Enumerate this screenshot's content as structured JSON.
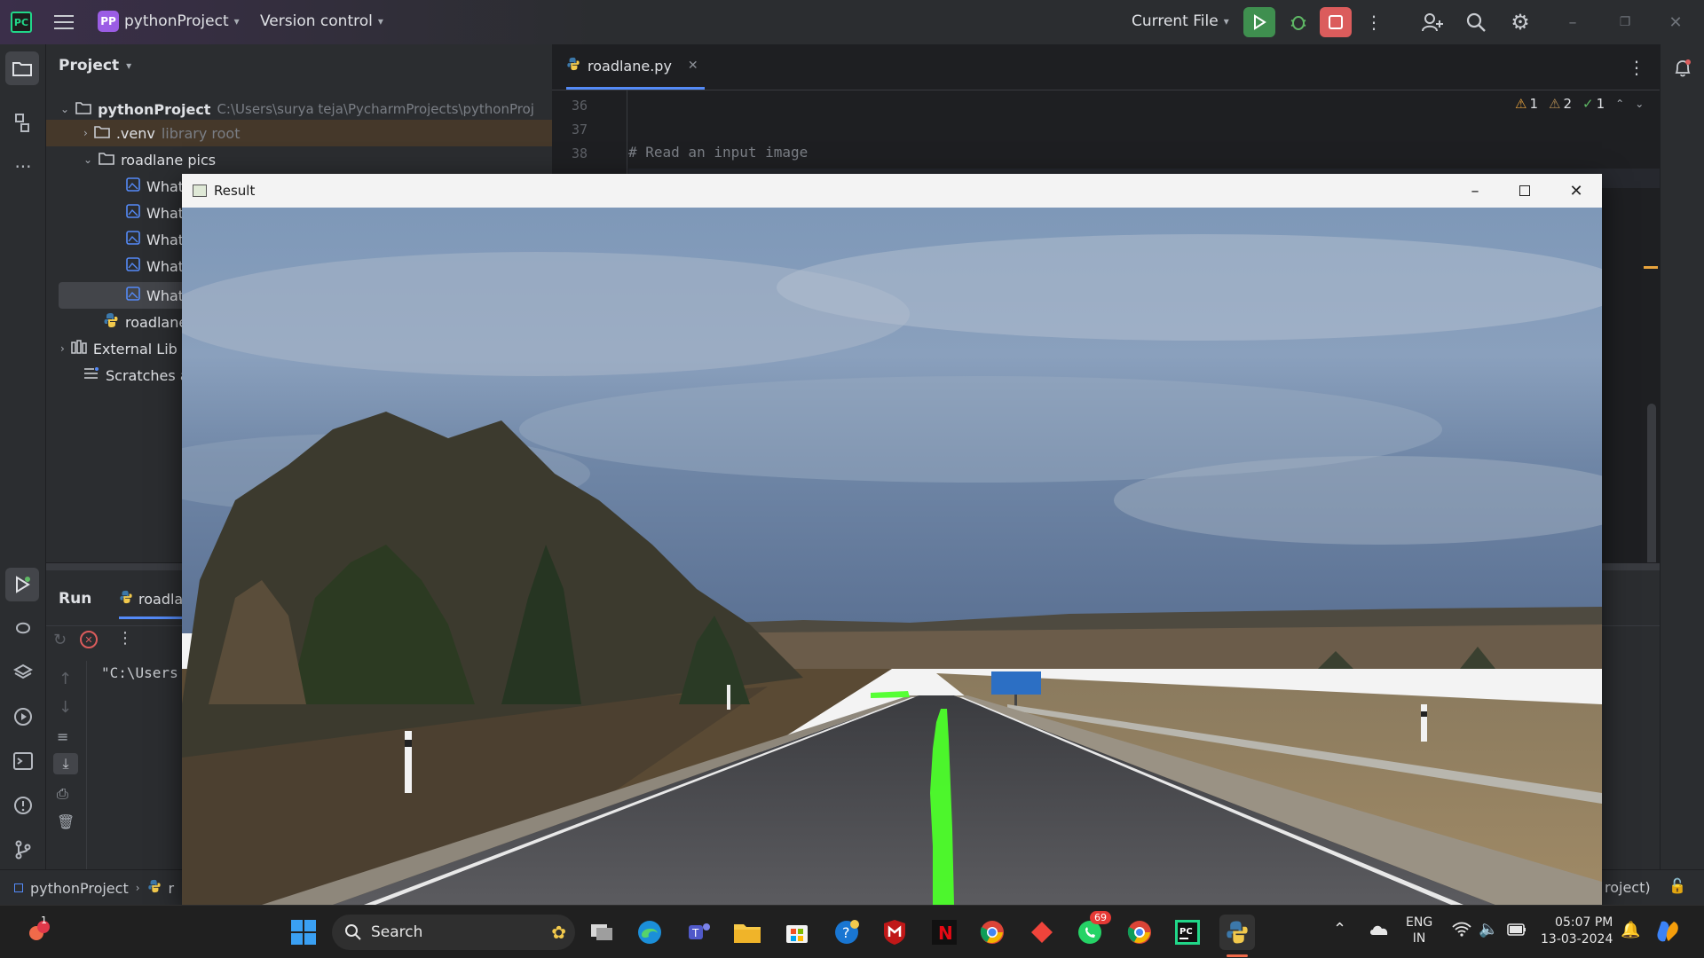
{
  "titlebar": {
    "project_badge": "PP",
    "project_name": "pythonProject",
    "version_control": "Version control",
    "run_config": "Current File"
  },
  "project_panel": {
    "title": "Project",
    "tree": [
      {
        "label": "pythonProject",
        "hint": "C:\\Users\\surya teja\\PycharmProjects\\pythonProj"
      },
      {
        "label": ".venv",
        "hint": "library root"
      },
      {
        "label": "roadlane pics",
        "hint": ""
      },
      {
        "label": "What",
        "hint": ""
      },
      {
        "label": "What",
        "hint": ""
      },
      {
        "label": "What",
        "hint": ""
      },
      {
        "label": "What",
        "hint": ""
      },
      {
        "label": "What",
        "hint": ""
      },
      {
        "label": "roadlane",
        "hint": ""
      },
      {
        "label": "External Lib",
        "hint": ""
      },
      {
        "label": "Scratches a",
        "hint": ""
      }
    ]
  },
  "editor": {
    "tab_label": "roadlane.py",
    "line_numbers": [
      "36",
      "37",
      "38"
    ],
    "code_comment": "# Read an input image",
    "inspections": {
      "warnings": "1",
      "weak_warnings": "2",
      "ok": "1"
    }
  },
  "run_panel": {
    "title": "Run",
    "tab_label": "roadla",
    "console_text": "\"C:\\Users"
  },
  "statusbar": {
    "breadcrumb_project": "pythonProject",
    "breadcrumb_next": "r",
    "right_text": "roject)"
  },
  "result_window": {
    "title": "Result"
  },
  "taskbar": {
    "search_placeholder": "Search",
    "whatsapp_badge": "69",
    "weather_badge": "1",
    "lang_top": "ENG",
    "lang_bottom": "IN",
    "time": "05:07 PM",
    "date": "13-03-2024"
  },
  "colors": {
    "ide_bg": "#2b2d30",
    "editor_bg": "#1e1f22",
    "run_green": "#3f8f4f",
    "stop_red": "#db5c5c",
    "lane_green": "#4dff2a"
  }
}
